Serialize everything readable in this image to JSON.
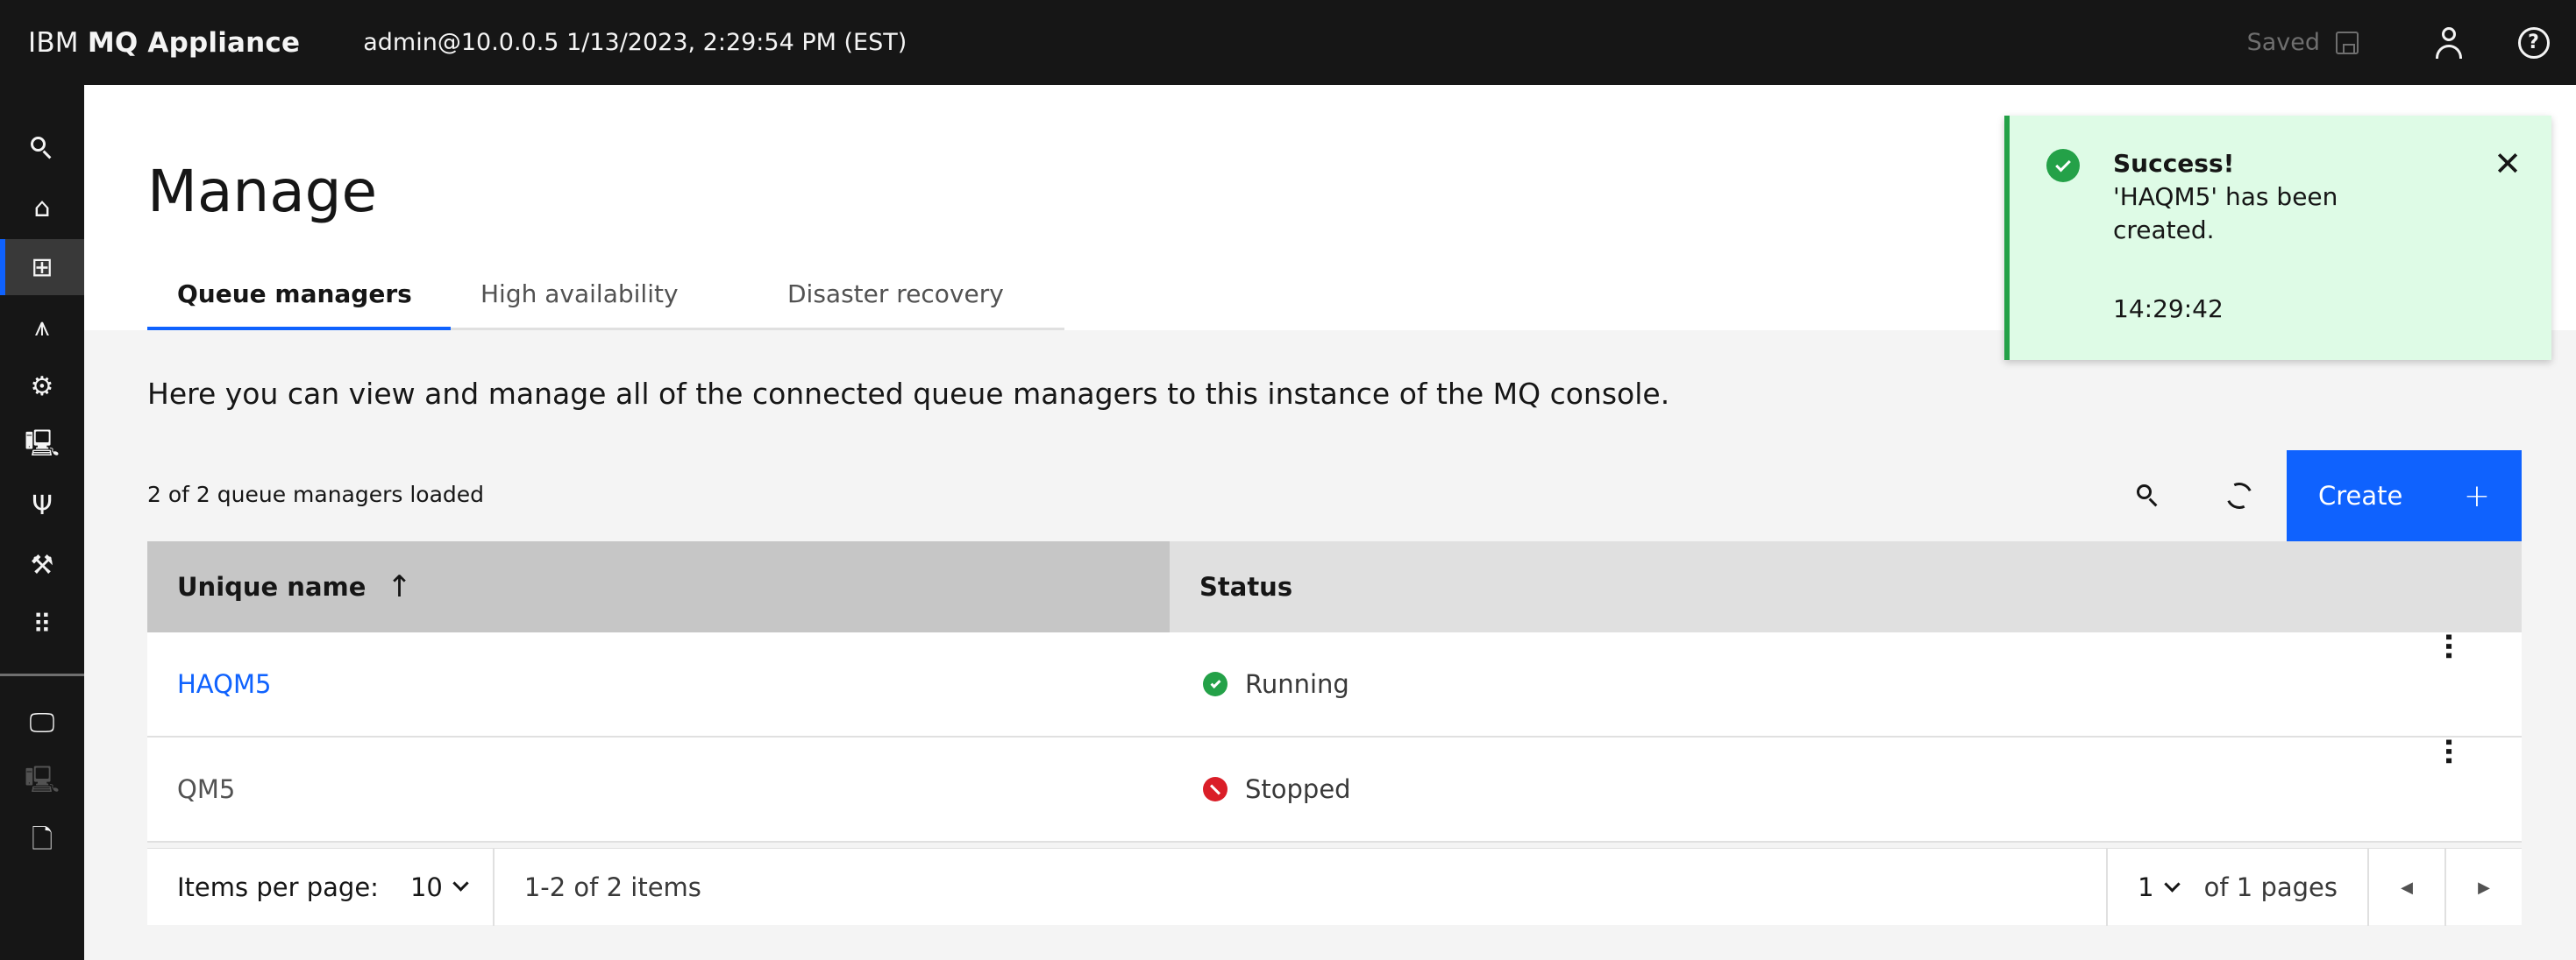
{
  "header": {
    "brand_prefix": "IBM",
    "brand_name": "MQ Appliance",
    "session": "admin@10.0.0.5 1/13/2023, 2:29:54 PM (EST)",
    "saved_label": "Saved"
  },
  "sidenav": {
    "items": [
      {
        "name": "search",
        "glyph": ""
      },
      {
        "name": "home",
        "glyph": "⌂"
      },
      {
        "name": "manage",
        "glyph": "⊞"
      },
      {
        "name": "network",
        "glyph": "⩚"
      },
      {
        "name": "settings",
        "glyph": "⚙"
      },
      {
        "name": "monitor",
        "glyph": "🖳"
      },
      {
        "name": "topology",
        "glyph": "Ψ"
      },
      {
        "name": "tools",
        "glyph": "⚒"
      },
      {
        "name": "apps",
        "glyph": "⠿"
      },
      {
        "name": "system-monitor",
        "glyph": "🖵"
      },
      {
        "name": "disabled-monitor",
        "glyph": "🖳"
      },
      {
        "name": "files",
        "glyph": "🗋"
      }
    ]
  },
  "page": {
    "title": "Manage",
    "tabs": [
      {
        "label": "Queue managers"
      },
      {
        "label": "High availability"
      },
      {
        "label": "Disaster recovery"
      }
    ],
    "intro": "Here you can view and manage all of the connected queue managers to this instance of the MQ console.",
    "loaded_text": "2 of 2 queue managers loaded",
    "create_label": "Create",
    "create_plus": "+"
  },
  "table": {
    "columns": [
      "Unique name",
      "Status"
    ],
    "sort_arrow": "↑",
    "rows": [
      {
        "name": "HAQM5",
        "status": "Running"
      },
      {
        "name": "QM5",
        "status": "Stopped"
      }
    ]
  },
  "pagination": {
    "items_per_page_label": "Items per page:",
    "items_per_page_value": "10",
    "range": "1-2 of 2 items",
    "page_value": "1",
    "of_pages": "of 1 pages"
  },
  "toast": {
    "title": "Success!",
    "message": "'HAQM5' has been created.",
    "time": "14:29:42",
    "close": "✕"
  },
  "colors": {
    "accent": "#0f62fe",
    "success": "#24a148",
    "error": "#da1e28",
    "header_bg": "#161616"
  }
}
